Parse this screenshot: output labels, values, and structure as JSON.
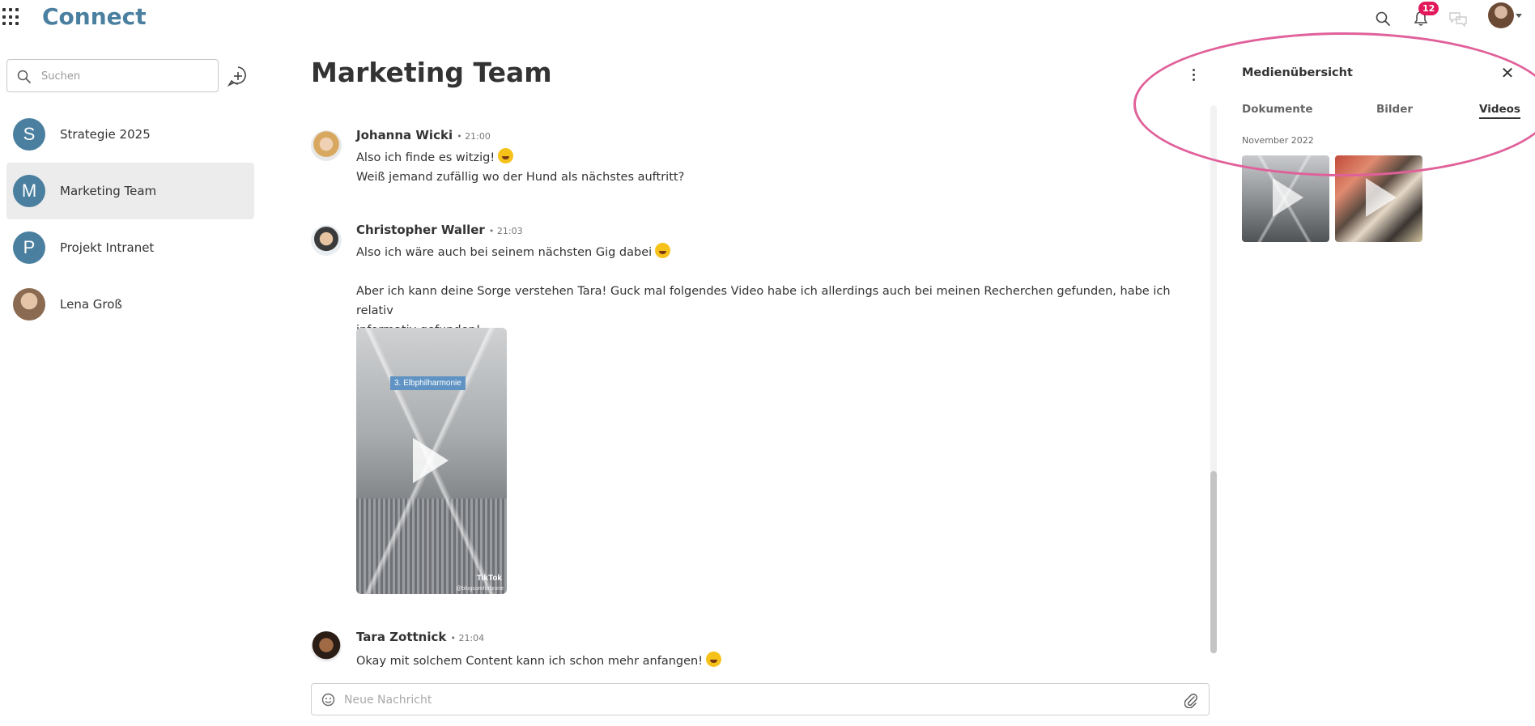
{
  "header": {
    "app_title": "Connect",
    "notification_count": "12",
    "icons": [
      "apps-grid-icon",
      "search-icon",
      "bell-icon",
      "chat-bubbles-icon",
      "user-avatar"
    ]
  },
  "sidebar": {
    "search_placeholder": "Suchen",
    "chats": [
      {
        "initial": "S",
        "label": "Strategie 2025"
      },
      {
        "initial": "M",
        "label": "Marketing Team",
        "active": true
      },
      {
        "initial": "P",
        "label": "Projekt Intranet"
      },
      {
        "initial": "",
        "label": "Lena Groß"
      }
    ]
  },
  "main": {
    "title": "Marketing Team",
    "messages": [
      {
        "author": "Johanna Wicki",
        "time": "• 21:00",
        "lines": [
          "Also ich finde es witzig!",
          "Weiß jemand zufällig wo der Hund als nächstes auftritt?"
        ]
      },
      {
        "author": "Christopher Waller",
        "time": "• 21:03",
        "lines": [
          "Also ich wäre auch bei seinem nächsten Gig dabei",
          "Aber ich kann deine Sorge verstehen Tara! Guck mal folgendes Video habe ich allerdings auch bei meinen Recherchen gefunden, habe ich relativ",
          "informativ gefunden!"
        ],
        "video": {
          "label": "3. Elbphilharmonie",
          "brand": "TikTok",
          "handle": "@blogcomfortzone"
        }
      },
      {
        "author": "Tara Zottnick",
        "time": "• 21:04",
        "lines": [
          "Okay mit solchem Content kann ich schon mehr anfangen!"
        ]
      }
    ],
    "composer_placeholder": "Neue Nachricht"
  },
  "media_panel": {
    "title": "Medienübersicht",
    "tabs": [
      "Dokumente",
      "Bilder",
      "Videos"
    ],
    "active_tab": "Videos",
    "date_group": "November 2022"
  },
  "colors": {
    "brand": "#4a7fa0",
    "badge": "#e2185b",
    "highlight": "#e0609a",
    "active_row": "#ececec"
  }
}
